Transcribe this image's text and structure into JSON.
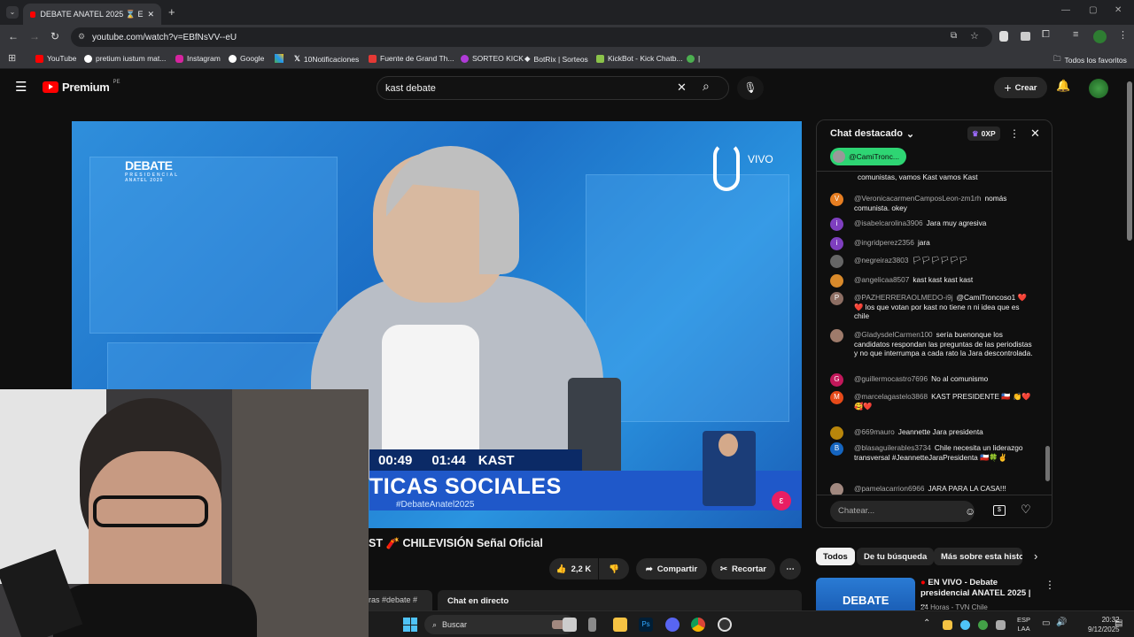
{
  "browser": {
    "tab_title": "DEBATE ANATEL 2025 ⌛ E",
    "url": "youtube.com/watch?v=EBfNsVV--eU",
    "bookmarks": [
      "YouTube",
      "pretium iustum mat...",
      "Instagram",
      "Google",
      "10Notificaciones",
      "Fuente de Grand Th...",
      "SORTEO KICK",
      "BotRix | Sorteos",
      "KickBot - Kick Chatb...",
      "|"
    ],
    "all_favorites": "Todos los favoritos"
  },
  "youtube": {
    "logo": "Premium",
    "region": "PE",
    "search_value": "kast debate",
    "create_label": "Crear"
  },
  "video": {
    "brand_top": "DEBATE",
    "brand_sub": "PRESIDENCIAL",
    "brand_sub2": "ANATEL 2025",
    "live_label": "VIVO",
    "timer_left": "00:49",
    "timer_right": "01:44",
    "speaker": "KAST",
    "topic": "TICAS SOCIALES",
    "hashtag": "#DebateAnatel2025"
  },
  "under_video": {
    "title": "ST 🧨 CHILEVISIÓN Señal Oficial",
    "likes": "2,2 K",
    "share": "Compartir",
    "clip": "Recortar",
    "desc_tags": "ras #debate #",
    "live_chat": "Chat en directo"
  },
  "chat": {
    "header": "Chat destacado",
    "xp": "0XP",
    "pinned_user": "@CamiTronc...",
    "input_placeholder": "Chatear...",
    "messages": [
      {
        "author": "",
        "text": "comunistas, vamos Kast vamos Kast",
        "avatar": "",
        "color": "#0f0f0f"
      },
      {
        "author": "@VeronicacarmenCamposLeon-zm1rh",
        "text": "nomás comunista. okey",
        "avatar": "V",
        "color": "#e67e22"
      },
      {
        "author": "@isabelcarolina3906",
        "text": "Jara muy agresiva",
        "avatar": "i",
        "color": "#7e3fbf"
      },
      {
        "author": "@ingridperez2356",
        "text": "jara",
        "avatar": "i",
        "color": "#7e3fbf"
      },
      {
        "author": "@negreiraz3803",
        "text": "🏳🏳🏳🏳🏳🏳",
        "avatar": "",
        "color": "#666"
      },
      {
        "author": "@angelicaa8507",
        "text": "kast kast kast kast",
        "avatar": "",
        "color": "#d98a2b"
      },
      {
        "author": "@PAZHERRERAOLMEDO-i9j",
        "text": "@CamiTroncoso1 ❤️❤️ los que votan por kast no tiene n ni idea que es chile",
        "avatar": "P",
        "color": "#8d6e63"
      },
      {
        "author": "@GladysdelCarmen100",
        "text": "sería buenonque los candidatos respondan las preguntas de las periodistas y no que interrumpa a cada rato la Jara descontrolada.",
        "avatar": "",
        "color": "#9e7b6b"
      },
      {
        "author": "@guillermocastro7696",
        "text": "No al comunismo",
        "avatar": "G",
        "color": "#c2185b"
      },
      {
        "author": "@marcelagastelo3868",
        "text": "KAST PRESIDENTE 🇨🇱 👏❤️🥰❤️",
        "avatar": "M",
        "color": "#e64a19"
      },
      {
        "author": "@669mauro",
        "text": "Jeannette Jara presidenta",
        "avatar": "",
        "color": "#b8860b"
      },
      {
        "author": "@blasaguilerables3734",
        "text": "Chile necesita un liderazgo transversal #JeannetteJaraPresidenta 🇨🇱🍀✌️",
        "avatar": "B",
        "color": "#1565c0"
      },
      {
        "author": "@pamelacarrion6966",
        "text": "JARA PARA LA CASA!!!",
        "avatar": "",
        "color": "#a1887f"
      }
    ]
  },
  "related": {
    "chips": [
      "Todos",
      "De tu búsqueda",
      "Más sobre esta histor"
    ],
    "video_title": "EN VIVO - Debate presidencial ANATEL 2025 | ...",
    "channel": "24 Horas - TVN Chile",
    "thumb_label": "DEBATE"
  },
  "taskbar": {
    "search": "Buscar",
    "lang_top": "ESP",
    "lang_bottom": "LAA",
    "time": "20:32",
    "date": "9/12/2025"
  }
}
